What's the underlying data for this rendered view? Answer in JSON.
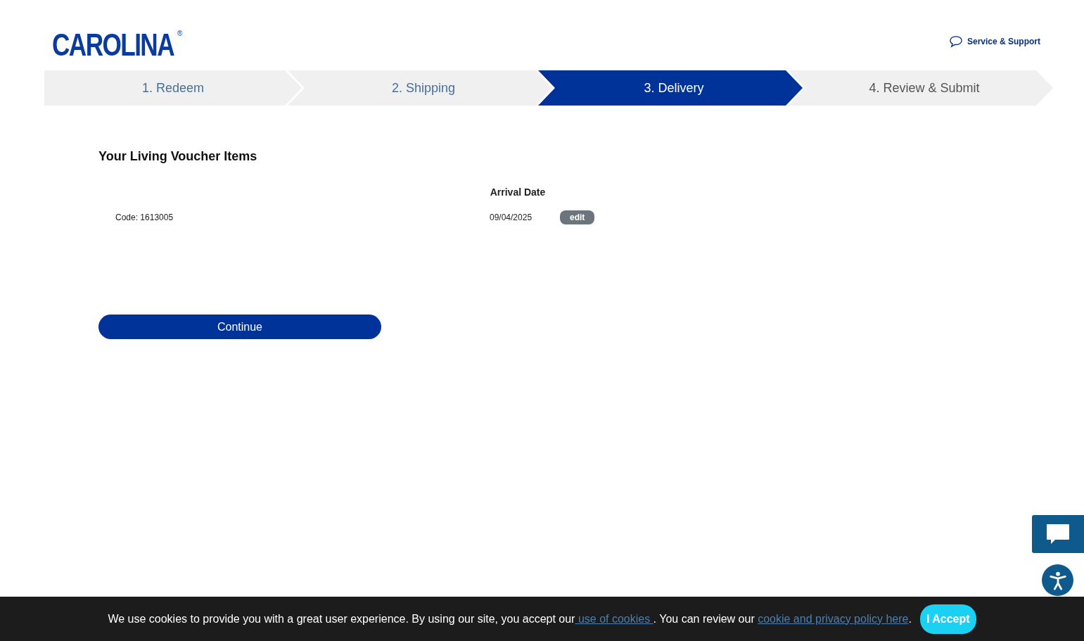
{
  "header": {
    "logo": "CAROLINA",
    "logo_mark": "®",
    "support_link": "Service & Support"
  },
  "steps": [
    {
      "label": "1. Redeem",
      "selected": false,
      "completed": true
    },
    {
      "label": "2. Shipping",
      "selected": false,
      "completed": true
    },
    {
      "label": "3. Delivery",
      "selected": true,
      "completed": false
    },
    {
      "label": "4. Review & Submit",
      "selected": false,
      "completed": false
    }
  ],
  "section_title": "Your Living Voucher Items",
  "table": {
    "columns": [
      "Arrival Date"
    ],
    "rows": [
      {
        "code": "Code: 1613005",
        "arrival_date": "09/04/2025",
        "action": "edit"
      }
    ]
  },
  "continue_button": "Continue",
  "cookie_banner": {
    "text_before": "We use cookies to provide you with a great user experience. By using our site, you accept our",
    "link_1": " use of cookies ",
    "text_middle": ". You can review our ",
    "link_2": "cookie and privacy policy here",
    "text_after": ".",
    "accept_button": "I Accept"
  }
}
